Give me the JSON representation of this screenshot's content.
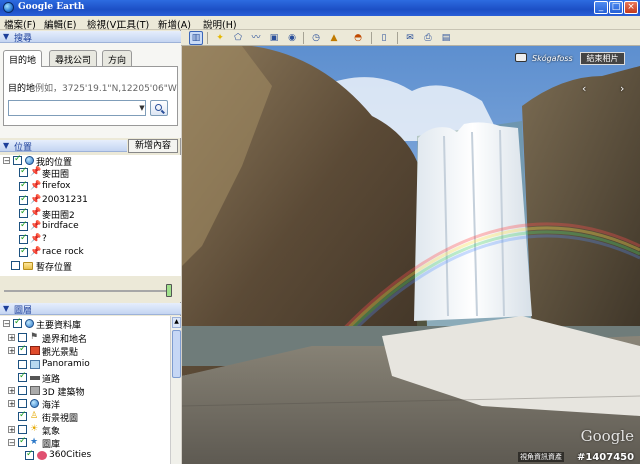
{
  "window": {
    "title": "Google Earth"
  },
  "menu": [
    "檔案(F)",
    "編輯(E)",
    "檢視(V)",
    "工具(T)",
    "新增(A)",
    "說明(H)"
  ],
  "search_panel": {
    "header": "搜尋",
    "tabs": [
      "目的地",
      "尋找公司",
      "方向"
    ],
    "hint_label": "目的地",
    "hint_example": "例如，3725'19.1\"N,12205'06\"W",
    "input_value": ""
  },
  "places_panel": {
    "header": "位置",
    "add_button": "新增內容",
    "root": "我的位置",
    "items": [
      "麥田圈",
      "firefox",
      "20031231",
      "麥田圈2",
      "birdface",
      "?",
      "race rock"
    ],
    "temp": "暫存位置"
  },
  "layers_panel": {
    "header": "圖層",
    "root": "主要資料庫",
    "items": [
      {
        "label": "邊界和地名",
        "checked": false
      },
      {
        "label": "觀光景點",
        "checked": true
      },
      {
        "label": "Panoramio",
        "checked": false
      },
      {
        "label": "道路",
        "checked": true
      },
      {
        "label": "3D 建築物",
        "checked": false
      },
      {
        "label": "海洋",
        "checked": false
      },
      {
        "label": "街景視圖",
        "checked": true
      },
      {
        "label": "氣象",
        "checked": false
      },
      {
        "label": "圖庫",
        "checked": true
      },
      {
        "label": "360Cities",
        "checked": true
      }
    ]
  },
  "toolbar": {
    "icons": [
      "sidebar-icon",
      "placemark-icon",
      "polygon-icon",
      "path-icon",
      "overlay-icon",
      "tour-icon",
      "history-icon",
      "sunlight-icon",
      "planet-icon",
      "ruler-icon",
      "email-icon",
      "print-icon",
      "maps-icon"
    ]
  },
  "viewer": {
    "label": "Skógafoss",
    "exit_button": "結束相片",
    "watermark": "Google",
    "copyright": "視角資訊資產",
    "post_id": "#1407450"
  },
  "colors": {
    "accent": "#1d3f9a",
    "titlebar": "#1c4fc5"
  }
}
